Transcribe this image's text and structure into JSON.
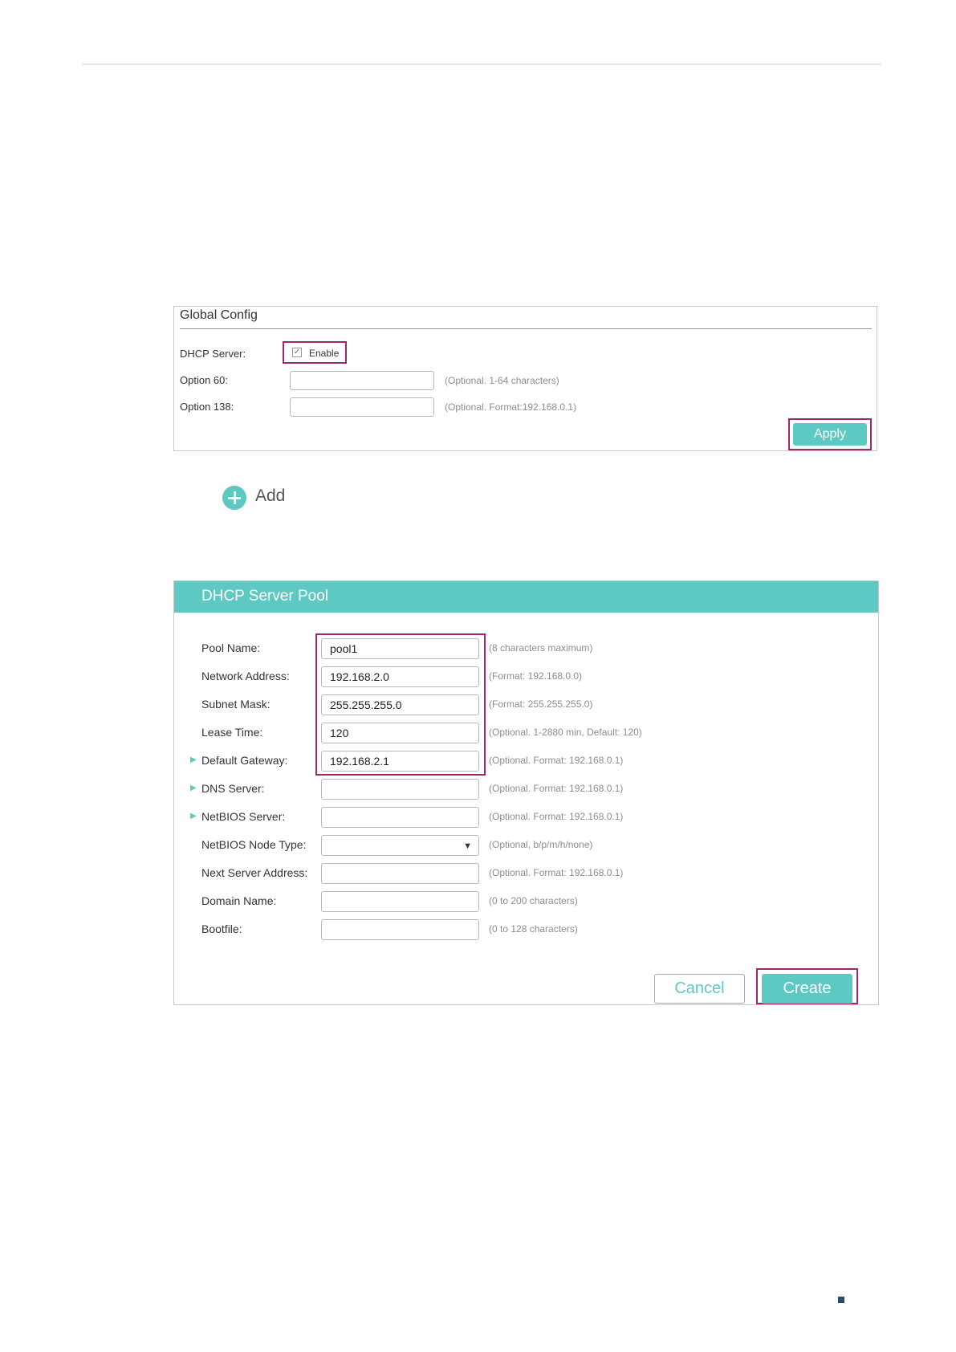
{
  "global_config": {
    "title": "Global Config",
    "dhcp_server_label": "DHCP Server:",
    "enable_label": "Enable",
    "enable_checked": true,
    "option60_label": "Option 60:",
    "option60_hint": "(Optional. 1-64 characters)",
    "option60_value": "",
    "option138_label": "Option 138:",
    "option138_hint": "(Optional. Format:192.168.0.1)",
    "option138_value": "",
    "apply_label": "Apply"
  },
  "add": {
    "label": "Add",
    "icon": "plus-circle-icon"
  },
  "pool": {
    "title": "DHCP Server Pool",
    "rows": [
      {
        "label": "Pool Name:",
        "value": "pool1",
        "hint": "(8 characters maximum)",
        "expandable": false
      },
      {
        "label": "Network Address:",
        "value": "192.168.2.0",
        "hint": "(Format: 192.168.0.0)",
        "expandable": false
      },
      {
        "label": "Subnet Mask:",
        "value": "255.255.255.0",
        "hint": "(Format: 255.255.255.0)",
        "expandable": false
      },
      {
        "label": "Lease Time:",
        "value": "120",
        "hint": "(Optional. 1-2880 min, Default: 120)",
        "expandable": false
      },
      {
        "label": "Default Gateway:",
        "value": "192.168.2.1",
        "hint": "(Optional. Format: 192.168.0.1)",
        "expandable": true
      },
      {
        "label": "DNS Server:",
        "value": "",
        "hint": "(Optional. Format: 192.168.0.1)",
        "expandable": true
      },
      {
        "label": "NetBIOS Server:",
        "value": "",
        "hint": "(Optional. Format: 192.168.0.1)",
        "expandable": true
      },
      {
        "label": "NetBIOS Node Type:",
        "value": "",
        "hint": "(Optional, b/p/m/h/none)",
        "expandable": false,
        "type": "select"
      },
      {
        "label": "Next Server Address:",
        "value": "",
        "hint": "(Optional. Format: 192.168.0.1)",
        "expandable": false
      },
      {
        "label": "Domain Name:",
        "value": "",
        "hint": "(0 to 200 characters)",
        "expandable": false
      },
      {
        "label": "Bootfile:",
        "value": "",
        "hint": "(0 to 128 characters)",
        "expandable": false
      }
    ],
    "cancel_label": "Cancel",
    "create_label": "Create"
  },
  "colors": {
    "accent": "#5ec8c3",
    "highlight": "#9c2a6a",
    "hint": "#8d8d8d"
  }
}
